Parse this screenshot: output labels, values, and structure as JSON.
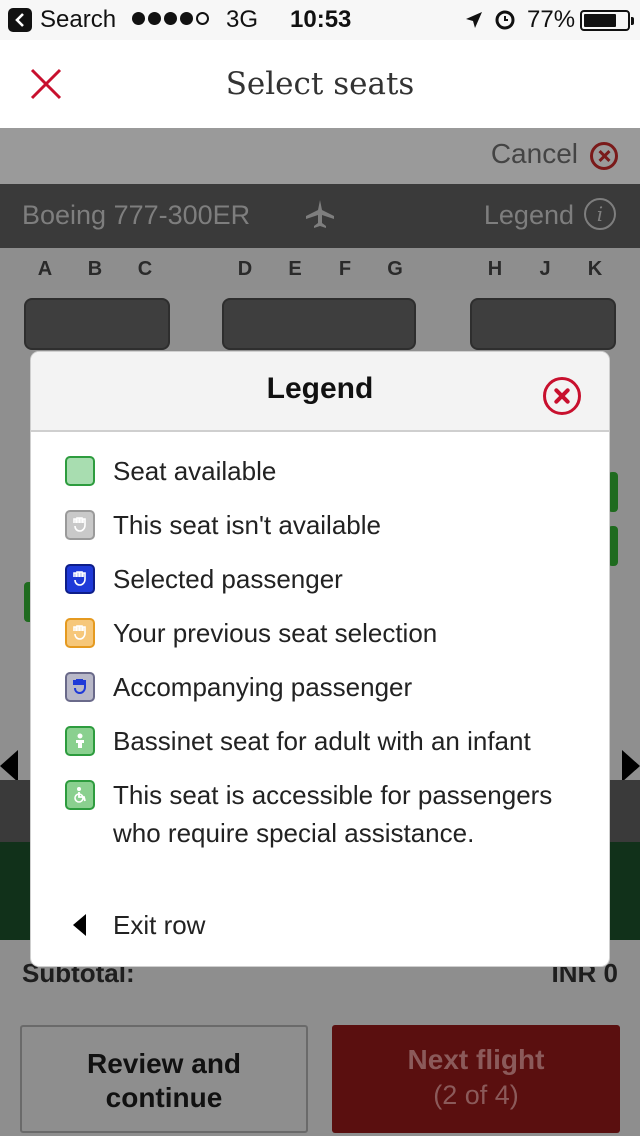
{
  "status_bar": {
    "back_label": "Search",
    "network": "3G",
    "time": "10:53",
    "battery_percent": "77%",
    "battery_level": 0.77,
    "signal_bars_filled": 4,
    "signal_bars_total": 5
  },
  "nav": {
    "title": "Select seats"
  },
  "seatmap": {
    "cancel_label": "Cancel",
    "aircraft": "Boeing 777-300ER",
    "legend_label": "Legend",
    "info_glyph": "i",
    "columns": [
      "A",
      "B",
      "C",
      "D",
      "E",
      "F",
      "G",
      "H",
      "J",
      "K"
    ],
    "subtotal_label": "Subtotal:",
    "subtotal_value": "INR 0"
  },
  "footer": {
    "review_line1": "Review and",
    "review_line2": "continue",
    "next_line1": "Next flight",
    "next_line2": "(2 of 4)"
  },
  "legend_modal": {
    "title": "Legend",
    "items": [
      {
        "icon": "seat-available-icon",
        "label": "Seat available"
      },
      {
        "icon": "seat-unavailable-icon",
        "label": "This seat isn't available"
      },
      {
        "icon": "selected-passenger-icon",
        "label": "Selected passenger"
      },
      {
        "icon": "previous-selection-icon",
        "label": "Your previous seat selection"
      },
      {
        "icon": "accompanying-passenger-icon",
        "label": "Accompanying passenger"
      },
      {
        "icon": "bassinet-seat-icon",
        "label": "Bassinet seat for adult with an infant"
      },
      {
        "icon": "accessible-seat-icon",
        "label": "This seat is accessible for passengers who require special assistance."
      },
      {
        "icon": "exit-row-icon",
        "label": "Exit row"
      }
    ]
  },
  "colors": {
    "brand_red": "#c8102e",
    "available_green": "#2d9c3e",
    "selected_blue": "#1f3ad8",
    "previous_orange": "#e59a20"
  }
}
